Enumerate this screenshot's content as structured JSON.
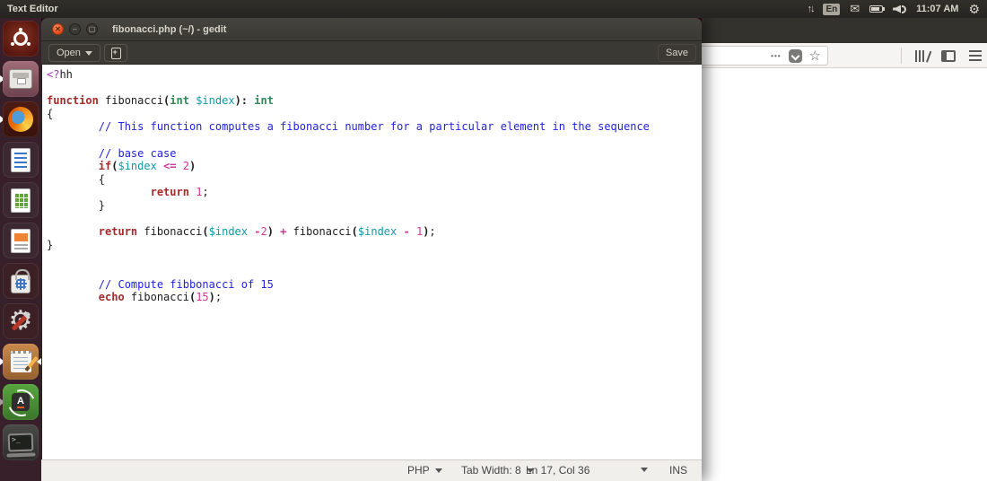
{
  "colors": {
    "keyword": "#a52a2a",
    "datatype": "#2e8b57",
    "variable": "#0e99a8",
    "comment": "#2222dd",
    "number": "#d63397",
    "operator": "#d63397",
    "preprocessor": "#9a35a8",
    "text": "#1c1c1c",
    "close_button": "#df4a16",
    "titlebar": "#3f3d38",
    "launcher_bg": "#37202a"
  },
  "topbar": {
    "app_name": "Text Editor",
    "keyboard_layout": "En",
    "time": "11:07 AM"
  },
  "launcher": {
    "items": [
      {
        "id": "dash",
        "label": "Ubuntu Dash"
      },
      {
        "id": "files",
        "label": "Files",
        "running": true
      },
      {
        "id": "firefox",
        "label": "Firefox Web Browser",
        "running": true
      },
      {
        "id": "writer",
        "label": "LibreOffice Writer"
      },
      {
        "id": "calc",
        "label": "LibreOffice Calc"
      },
      {
        "id": "impress",
        "label": "LibreOffice Impress"
      },
      {
        "id": "software",
        "label": "Ubuntu Software"
      },
      {
        "id": "settings",
        "label": "System Settings"
      },
      {
        "id": "gedit",
        "label": "Text Editor",
        "running": true,
        "focused": true
      },
      {
        "id": "updater",
        "label": "Software Updater",
        "running": true,
        "hollow": true
      },
      {
        "id": "terminal",
        "label": "Terminal"
      }
    ]
  },
  "gedit": {
    "titlebar": {
      "title": "fibonacci.php (~/) - gedit"
    },
    "toolbar": {
      "open_label": "Open",
      "save_label": "Save"
    },
    "statusbar": {
      "language": "PHP",
      "tab_width": "Tab Width: 8",
      "cursor_position": "Ln 17, Col 36",
      "insert_mode": "INS"
    },
    "code": {
      "lines": [
        [
          {
            "t": "<?",
            "s": "pre"
          },
          {
            "t": "hh",
            "s": "pl"
          }
        ],
        [],
        [
          {
            "t": "function",
            "s": "kw"
          },
          {
            "t": " fibonacci",
            "s": "pl"
          },
          {
            "t": "(",
            "s": "b"
          },
          {
            "t": "int",
            "s": "ty"
          },
          {
            "t": " ",
            "s": "pl"
          },
          {
            "t": "$index",
            "s": "va"
          },
          {
            "t": "): ",
            "s": "b"
          },
          {
            "t": "int",
            "s": "ty"
          }
        ],
        [
          {
            "t": "{",
            "s": "pl"
          }
        ],
        [
          {
            "t": "\t",
            "s": "pl"
          },
          {
            "t": "// This function computes a fibonacci number for a particular element in the sequence",
            "s": "co"
          }
        ],
        [],
        [
          {
            "t": "\t",
            "s": "pl"
          },
          {
            "t": "// base case",
            "s": "co"
          }
        ],
        [
          {
            "t": "\t",
            "s": "pl"
          },
          {
            "t": "if",
            "s": "kw"
          },
          {
            "t": "(",
            "s": "b"
          },
          {
            "t": "$index",
            "s": "va"
          },
          {
            "t": " ",
            "s": "pl"
          },
          {
            "t": "<=",
            "s": "op"
          },
          {
            "t": " ",
            "s": "pl"
          },
          {
            "t": "2",
            "s": "nu"
          },
          {
            "t": ")",
            "s": "b"
          }
        ],
        [
          {
            "t": "\t{",
            "s": "pl"
          }
        ],
        [
          {
            "t": "\t\t",
            "s": "pl"
          },
          {
            "t": "return",
            "s": "kw"
          },
          {
            "t": " ",
            "s": "pl"
          },
          {
            "t": "1",
            "s": "nu"
          },
          {
            "t": ";",
            "s": "pl"
          }
        ],
        [
          {
            "t": "\t}",
            "s": "pl"
          }
        ],
        [],
        [
          {
            "t": "\t",
            "s": "pl"
          },
          {
            "t": "return",
            "s": "kw"
          },
          {
            "t": " fibonacci",
            "s": "pl"
          },
          {
            "t": "(",
            "s": "b"
          },
          {
            "t": "$index",
            "s": "va"
          },
          {
            "t": " ",
            "s": "pl"
          },
          {
            "t": "-",
            "s": "op"
          },
          {
            "t": "2",
            "s": "nu"
          },
          {
            "t": ")",
            "s": "b"
          },
          {
            "t": " ",
            "s": "pl"
          },
          {
            "t": "+",
            "s": "op"
          },
          {
            "t": " fibonacci",
            "s": "pl"
          },
          {
            "t": "(",
            "s": "b"
          },
          {
            "t": "$index",
            "s": "va"
          },
          {
            "t": " ",
            "s": "pl"
          },
          {
            "t": "-",
            "s": "op"
          },
          {
            "t": " ",
            "s": "pl"
          },
          {
            "t": "1",
            "s": "nu"
          },
          {
            "t": ")",
            "s": "b"
          },
          {
            "t": ";",
            "s": "pl"
          }
        ],
        [
          {
            "t": "}",
            "s": "pl"
          }
        ],
        [],
        [],
        [
          {
            "t": "\t",
            "s": "pl"
          },
          {
            "t": "// Compute fibbonacci of 15",
            "s": "co"
          }
        ],
        [
          {
            "t": "\t",
            "s": "pl"
          },
          {
            "t": "echo",
            "s": "kw"
          },
          {
            "t": " fibonacci",
            "s": "pl"
          },
          {
            "t": "(",
            "s": "b"
          },
          {
            "t": "15",
            "s": "nu"
          },
          {
            "t": ")",
            "s": "b"
          },
          {
            "t": ";",
            "s": "pl"
          }
        ]
      ]
    }
  },
  "firefox": {
    "urlbar": {
      "page_actions": "•••"
    }
  }
}
